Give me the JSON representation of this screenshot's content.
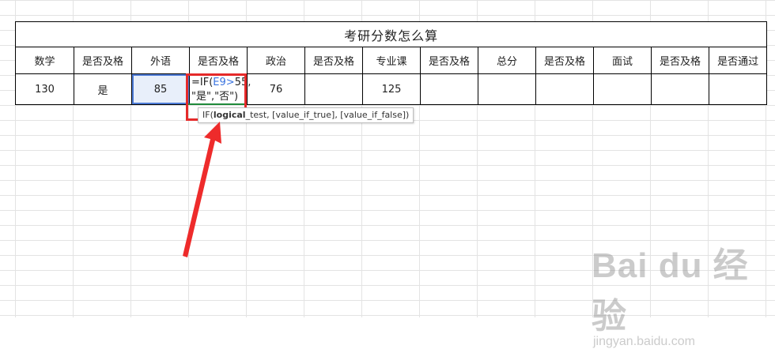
{
  "sheet": {
    "title": "考研分数怎么算",
    "headers": [
      "数学",
      "是否及格",
      "外语",
      "是否及格",
      "政治",
      "是否及格",
      "专业课",
      "是否及格",
      "总分",
      "是否及格",
      "面试",
      "是否及格",
      "是否通过"
    ],
    "row": [
      "130",
      "是",
      "85",
      "",
      "76",
      "",
      "125",
      "",
      "",
      "",
      "",
      "",
      ""
    ]
  },
  "formula": {
    "prefix": "=IF(",
    "ref": "E9",
    "op": ">",
    "rest": "55,",
    "line2": "\"是\",\"否\")"
  },
  "tooltip": {
    "fn": "IF(",
    "arg_bold": "logical",
    "rest": "_test, [value_if_true], [value_if_false])"
  },
  "watermark": {
    "logo": "Bai du 经验",
    "url": "jingyan.baidu.com"
  },
  "colors": {
    "highlight": "#e52a2a",
    "selection": "#4d7bd6",
    "reference": "#3b74e0"
  }
}
